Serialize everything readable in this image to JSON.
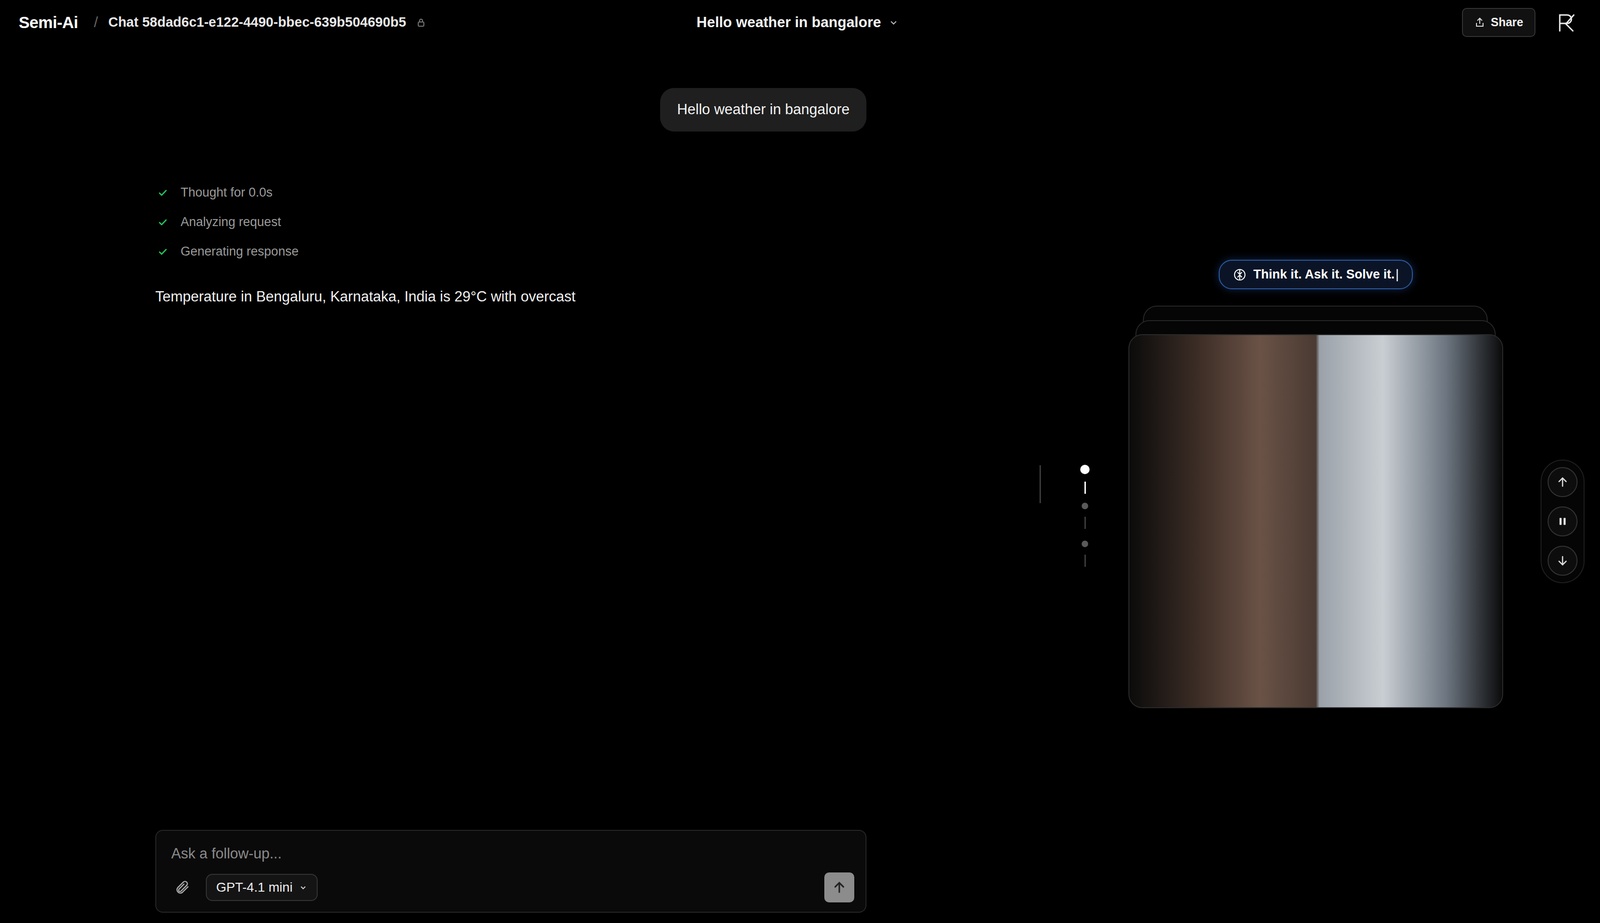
{
  "header": {
    "brand": "Semi-Ai",
    "separator": "/",
    "chat_title": "Chat 58dad6c1-e122-4490-bbec-639b504690b5",
    "conversation_title": "Hello weather in bangalore",
    "share_label": "Share"
  },
  "user_message": "Hello weather in bangalore",
  "steps": [
    {
      "label": "Thought for 0.0s",
      "done": true
    },
    {
      "label": "Analyzing request",
      "done": true
    },
    {
      "label": "Generating response",
      "done": true
    }
  ],
  "response": "Temperature in Bengaluru, Karnataka, India is 29°C with overcast",
  "showcase": {
    "tagline": "Think it. Ask it. Solve it.",
    "cursor": "|",
    "playing": true,
    "slides": [
      {
        "selected": true
      },
      {
        "selected": false
      },
      {
        "selected": false
      }
    ]
  },
  "composer": {
    "placeholder": "Ask a follow-up...",
    "model": "GPT-4.1 mini"
  }
}
